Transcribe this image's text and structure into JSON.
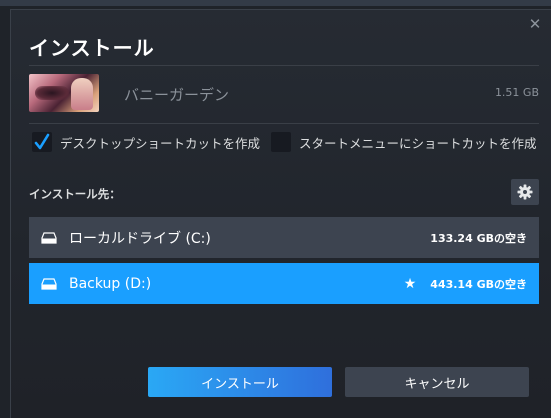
{
  "dialog": {
    "title": "インストール",
    "close_glyph": "✕"
  },
  "game": {
    "name": "バニーガーデン",
    "size": "1.51 GB",
    "thumbnail_icon": "game-thumbnail"
  },
  "options": {
    "desktop_shortcut": {
      "label": "デスクトップショートカットを作成",
      "checked": true
    },
    "startmenu_shortcut": {
      "label": "スタートメニューにショートカットを作成",
      "checked": false
    }
  },
  "destination": {
    "label": "インストール先：",
    "settings_icon": "gear-icon",
    "drives": [
      {
        "name": "ローカルドライブ (C:)",
        "free": "133.24 GBの空き",
        "selected": false,
        "default": false
      },
      {
        "name": "Backup (D:)",
        "free": "443.14 GBの空き",
        "selected": true,
        "default": true
      }
    ]
  },
  "buttons": {
    "install": "インストール",
    "cancel": "キャンセル"
  },
  "colors": {
    "accent": "#1a9fff",
    "panel": "#3d4450",
    "background": "#21252c"
  }
}
